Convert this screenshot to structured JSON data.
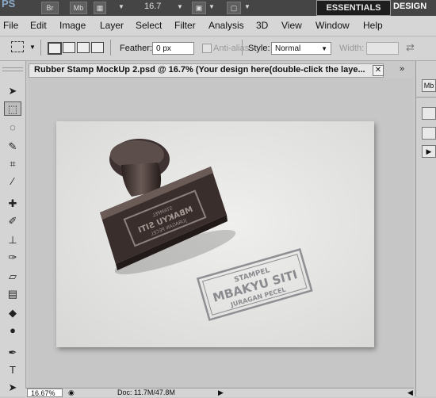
{
  "app": {
    "logo": "PS",
    "br_label": "Br",
    "mb_label": "Mb",
    "zoom_value": "16.7",
    "workspace_active": "ESSENTIALS",
    "workspace_other": "DESIGN"
  },
  "menu": [
    "File",
    "Edit",
    "Image",
    "Layer",
    "Select",
    "Filter",
    "Analysis",
    "3D",
    "View",
    "Window",
    "Help"
  ],
  "options": {
    "feather_label": "Feather:",
    "feather_value": "0 px",
    "antialias_label": "Anti-alias",
    "style_label": "Style:",
    "style_value": "Normal",
    "width_label": "Width:"
  },
  "document": {
    "tab_title": "Rubber Stamp  MockUp 2.psd @ 16.7% (Your design here(double-click the laye...",
    "close_glyph": "✕",
    "panel_arrow": "»"
  },
  "stamp": {
    "top_text": "STAMPEL",
    "main_text": "MBAKYU SITI",
    "bottom_text": "JURAGAN PECEL"
  },
  "status": {
    "zoom": "16.67%",
    "doc": "Doc: 11.7M/47.8M"
  },
  "right_panel": {
    "mb_label": "Mb"
  },
  "tools": [
    {
      "name": "move-tool-icon",
      "glyph": "➤"
    },
    {
      "name": "marquee-tool-icon",
      "glyph": "⬚"
    },
    {
      "name": "lasso-tool-icon",
      "glyph": "◌"
    },
    {
      "name": "quick-select-tool-icon",
      "glyph": "✎"
    },
    {
      "name": "crop-tool-icon",
      "glyph": "⌗"
    },
    {
      "name": "eyedropper-tool-icon",
      "glyph": "⁄"
    },
    {
      "name": "healing-brush-tool-icon",
      "glyph": "✚"
    },
    {
      "name": "brush-tool-icon",
      "glyph": "✐"
    },
    {
      "name": "clone-stamp-tool-icon",
      "glyph": "⊥"
    },
    {
      "name": "history-brush-tool-icon",
      "glyph": "✑"
    },
    {
      "name": "eraser-tool-icon",
      "glyph": "▱"
    },
    {
      "name": "gradient-tool-icon",
      "glyph": "▤"
    },
    {
      "name": "blur-tool-icon",
      "glyph": "◆"
    },
    {
      "name": "dodge-tool-icon",
      "glyph": "●"
    },
    {
      "name": "pen-tool-icon",
      "glyph": "✒"
    },
    {
      "name": "type-tool-icon",
      "glyph": "T"
    },
    {
      "name": "path-select-tool-icon",
      "glyph": "➤"
    }
  ]
}
